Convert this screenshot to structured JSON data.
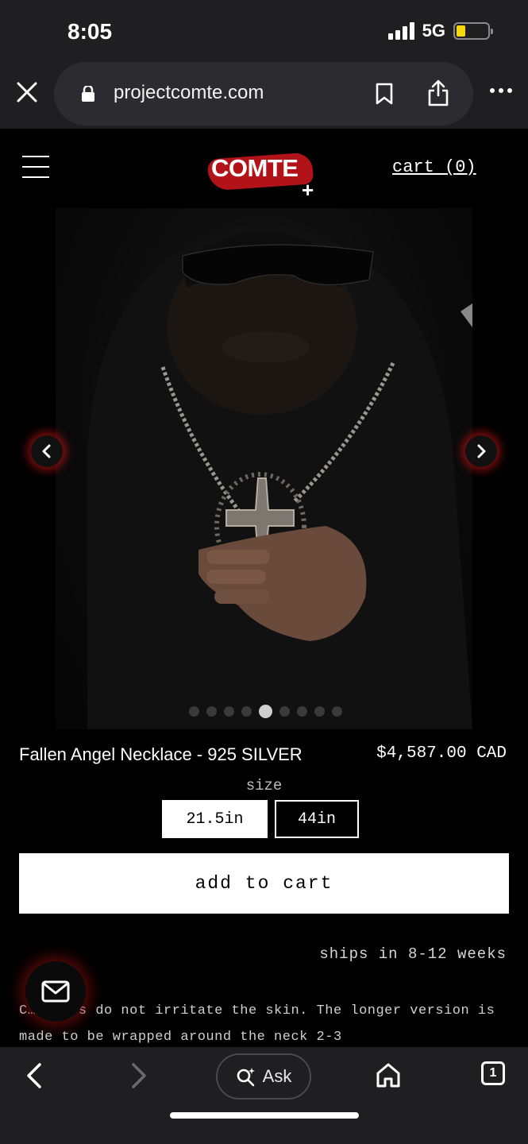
{
  "status_bar": {
    "time": "8:05",
    "network": "5G",
    "battery_level": 0.3,
    "battery_color": "#f5d90a"
  },
  "browser": {
    "url": "projectcomte.com",
    "icons": [
      "close-icon",
      "lock-icon",
      "bookmark-icon",
      "share-icon",
      "more-icon"
    ]
  },
  "site": {
    "logo_text": "COMTE",
    "logo_plus": "+",
    "cart_label": "cart (0)",
    "accent_color": "#c4151c"
  },
  "carousel": {
    "slide_count": 9,
    "active_index": 4
  },
  "product": {
    "title": "Fallen Angel Necklace - 925 SILVER",
    "price": "$4,587.00 CAD",
    "size_label": "size",
    "sizes": [
      "21.5in",
      "44in"
    ],
    "selected_size": "21.5in",
    "add_to_cart_label": "add to cart",
    "shipping": "ships in 8-12 weeks",
    "description": "C… pikes do not irritate the skin. The longer version is made to be wrapped around the neck 2-3"
  },
  "bottom_bar": {
    "ask_label": "Ask",
    "tab_count": "1"
  }
}
